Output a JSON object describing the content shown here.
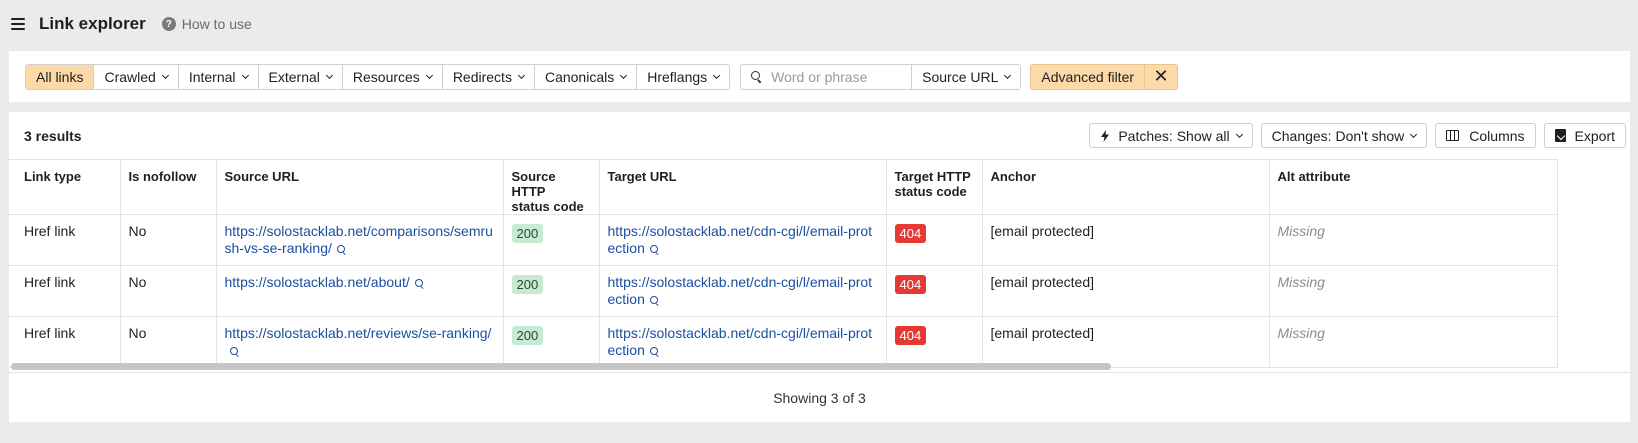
{
  "header": {
    "title": "Link explorer",
    "help_label": "How to use"
  },
  "filters": {
    "segments": [
      {
        "label": "All links",
        "active": true
      },
      {
        "label": "Crawled",
        "dropdown": true
      },
      {
        "label": "Internal",
        "dropdown": true
      },
      {
        "label": "External",
        "dropdown": true
      },
      {
        "label": "Resources",
        "dropdown": true
      },
      {
        "label": "Redirects",
        "dropdown": true
      },
      {
        "label": "Canonicals",
        "dropdown": true
      },
      {
        "label": "Hreflangs",
        "dropdown": true
      }
    ],
    "search_placeholder": "Word or phrase",
    "search_value": "",
    "search_field_select": "Source URL",
    "advanced_filter_label": "Advanced filter"
  },
  "results": {
    "count_label": "3 results",
    "patches_label": "Patches: Show all",
    "changes_label": "Changes: Don't show",
    "columns_label": "Columns",
    "export_label": "Export",
    "columns": {
      "link_type": "Link type",
      "is_nofollow": "Is nofollow",
      "source_url": "Source URL",
      "source_status_1": "Source HTTP",
      "source_status_2": "status code",
      "target_url": "Target URL",
      "target_status_1": "Target HTTP",
      "target_status_2": "status code",
      "anchor": "Anchor",
      "alt": "Alt attribute"
    },
    "rows": [
      {
        "link_type": "Href link",
        "is_nofollow": "No",
        "source_url": "https://solostacklab.net/comparisons/semrush-vs-se-ranking/",
        "source_status": "200",
        "target_url": "https://solostacklab.net/cdn-cgi/l/email-protection",
        "target_status": "404",
        "anchor": "[email protected]",
        "alt": "Missing"
      },
      {
        "link_type": "Href link",
        "is_nofollow": "No",
        "source_url": "https://solostacklab.net/about/",
        "source_status": "200",
        "target_url": "https://solostacklab.net/cdn-cgi/l/email-protection",
        "target_status": "404",
        "anchor": "[email protected]",
        "alt": "Missing"
      },
      {
        "link_type": "Href link",
        "is_nofollow": "No",
        "source_url": "https://solostacklab.net/reviews/se-ranking/",
        "source_status": "200",
        "target_url": "https://solostacklab.net/cdn-cgi/l/email-protection",
        "target_status": "404",
        "anchor": "[email protected]",
        "alt": "Missing"
      }
    ],
    "footer_label": "Showing 3 of 3"
  },
  "colors": {
    "active_filter": "#fbd9a8",
    "status_ok": "#c8ead2",
    "status_error": "#e53935",
    "link": "#1a4fa0"
  },
  "icons": [
    "hamburger-icon",
    "help-icon",
    "chevron-down-icon",
    "search-icon",
    "close-icon",
    "bolt-icon",
    "columns-icon",
    "export-icon",
    "zoom-icon"
  ]
}
